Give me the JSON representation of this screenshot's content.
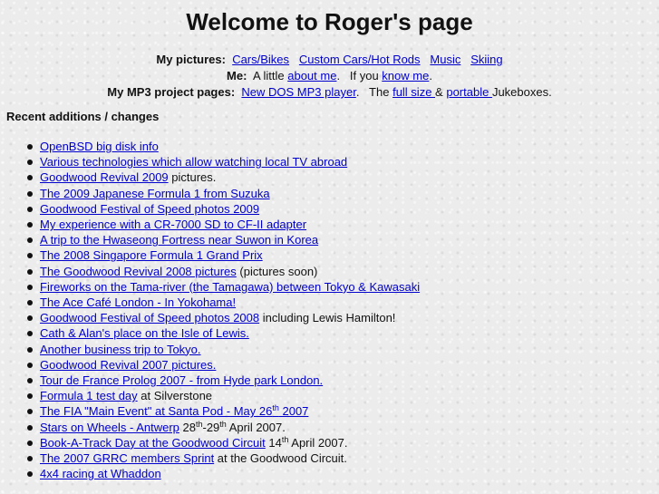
{
  "page": {
    "title": "Welcome to Roger's page"
  },
  "nav": {
    "pictures": {
      "label": "My pictures:",
      "links": [
        "Cars/Bikes",
        "Custom Cars/Hot Rods",
        "Music",
        "Skiing"
      ]
    },
    "me": {
      "label": "Me:",
      "t1": "A little ",
      "about": "about me",
      "t2": ".   If you ",
      "know": "know me",
      "t3": "."
    },
    "mp3": {
      "label": "My MP3 project pages:",
      "dos": "New DOS MP3 player",
      "t1": ".   The ",
      "fullsize": "full size ",
      "t2": "& ",
      "portable": "portable ",
      "t3": "Jukeboxes."
    }
  },
  "recent": {
    "heading": "Recent additions / changes",
    "items": [
      {
        "link": "OpenBSD big disk info"
      },
      {
        "link": "Various technologies which allow watching local TV abroad"
      },
      {
        "link": "Goodwood Revival 2009",
        "after": " pictures."
      },
      {
        "link": "The 2009 Japanese Formula 1 from Suzuka"
      },
      {
        "link": "Goodwood Festival of Speed photos 2009"
      },
      {
        "link": "My experience with a CR-7000 SD to CF-II adapter"
      },
      {
        "link": "A trip to the Hwaseong Fortress near Suwon in Korea"
      },
      {
        "link": "The 2008 Singapore Formula 1 Grand Prix"
      },
      {
        "link": "The Goodwood Revival 2008 pictures",
        "after": " (pictures soon)"
      },
      {
        "link": "Fireworks on the Tama-river (the Tamagawa) between Tokyo & Kawasaki"
      },
      {
        "link": "The Ace Café London - In Yokohama!"
      },
      {
        "link": "Goodwood Festival of Speed photos 2008",
        "after": " including Lewis Hamilton!"
      },
      {
        "link": "Cath & Alan's place on the Isle of Lewis."
      },
      {
        "link": "Another business trip to Tokyo."
      },
      {
        "link": "Goodwood Revival 2007 pictures."
      },
      {
        "link": "Tour de France Prolog 2007 - from Hyde park London."
      },
      {
        "link": "Formula 1 test day",
        "after": " at Silverstone"
      },
      {
        "santapod": {
          "pre": "The FIA \"Main Event\" at Santa Pod - May 26",
          "sup": "th",
          "post": " 2007"
        }
      },
      {
        "antwerp": {
          "link": "Stars on Wheels - Antwerp",
          "d1": " 28",
          "s1": "th",
          "d2": "-29",
          "s2": "th",
          "post": " April 2007."
        }
      },
      {
        "booka": {
          "link": "Book-A-Track Day at the Goodwood Circuit",
          "d": " 14",
          "s": "th",
          "post": " April 2007."
        }
      },
      {
        "link": "The 2007 GRRC members Sprint",
        "after": " at the Goodwood Circuit."
      },
      {
        "link": "4x4 racing at Whaddon"
      }
    ]
  }
}
